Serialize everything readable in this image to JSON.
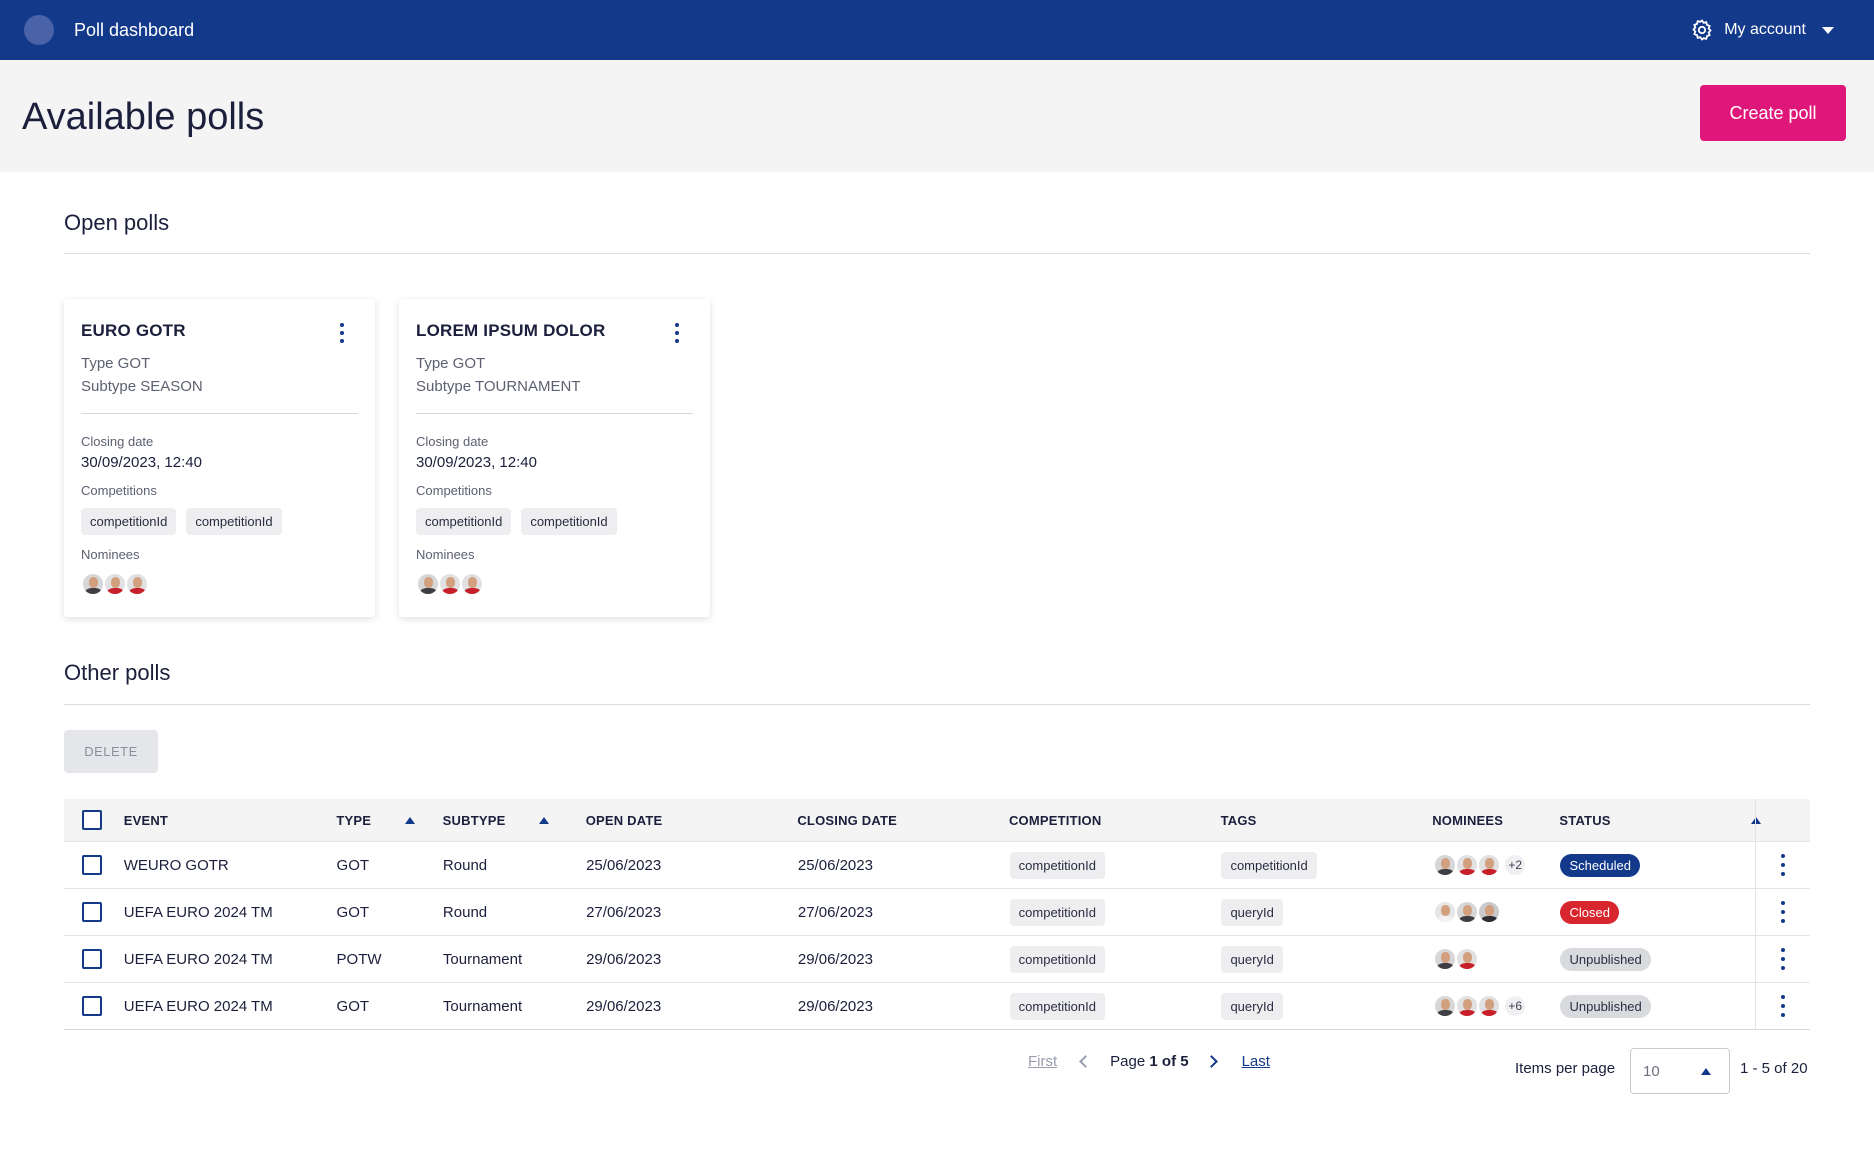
{
  "app": {
    "title": "Poll dashboard",
    "account_label": "My account"
  },
  "header": {
    "page_title": "Available polls",
    "create_button": "Create poll"
  },
  "open_polls": {
    "section_title": "Open polls",
    "cards": [
      {
        "title": "EURO GOTR",
        "type_line": "Type GOT",
        "subtype_line": "Subtype SEASON",
        "closing_label": "Closing date",
        "closing_date": "30/09/2023, 12:40",
        "competitions_label": "Competitions",
        "competitions": [
          "competitionId",
          "competitionId"
        ],
        "nominees_label": "Nominees",
        "nominee_icons": [
          "player-avatar-icon",
          "player-avatar-icon",
          "player-avatar-icon"
        ]
      },
      {
        "title": "LOREM IPSUM DOLOR",
        "type_line": "Type GOT",
        "subtype_line": "Subtype TOURNAMENT",
        "closing_label": "Closing date",
        "closing_date": "30/09/2023, 12:40",
        "competitions_label": "Competitions",
        "competitions": [
          "competitionId",
          "competitionId"
        ],
        "nominees_label": "Nominees",
        "nominee_icons": [
          "player-avatar-icon",
          "player-avatar-icon",
          "player-avatar-icon"
        ]
      }
    ]
  },
  "other_polls": {
    "section_title": "Other polls",
    "delete_button": "DELETE",
    "columns": {
      "event": "EVENT",
      "type": "TYPE",
      "subtype": "SUBTYPE",
      "open_date": "OPEN DATE",
      "closing_date": "CLOSING DATE",
      "competition": "COMPETITION",
      "tags": "TAGS",
      "nominees": "NOMINEES",
      "status": "STATUS"
    },
    "rows": [
      {
        "event": "WEURO GOTR",
        "type": "GOT",
        "subtype": "Round",
        "open_date": "25/06/2023",
        "closing_date": "25/06/2023",
        "competition": "competitionId",
        "tags": "competitionId",
        "nominees_extra": "+2",
        "status": "Scheduled"
      },
      {
        "event": "UEFA EURO 2024 TM",
        "type": "GOT",
        "subtype": "Round",
        "open_date": "27/06/2023",
        "closing_date": "27/06/2023",
        "competition": "competitionId",
        "tags": "queryId",
        "nominees_extra": "",
        "status": "Closed"
      },
      {
        "event": "UEFA EURO 2024 TM",
        "type": "POTW",
        "subtype": "Tournament",
        "open_date": "29/06/2023",
        "closing_date": "29/06/2023",
        "competition": "competitionId",
        "tags": "queryId",
        "nominees_extra": "",
        "status": "Unpublished"
      },
      {
        "event": "UEFA EURO 2024 TM",
        "type": "GOT",
        "subtype": "Tournament",
        "open_date": "29/06/2023",
        "closing_date": "29/06/2023",
        "competition": "competitionId",
        "tags": "queryId",
        "nominees_extra": "+6",
        "status": "Unpublished"
      }
    ]
  },
  "pagination": {
    "first": "First",
    "page_prefix": "Page",
    "page_current": "1",
    "page_of": "of",
    "page_total": "5",
    "last": "Last",
    "items_per_page_label": "Items per page",
    "items_per_page_value": "10",
    "range": "1 - 5 of 20"
  },
  "colors": {
    "brand_blue": "#13398a",
    "accent_pink": "#e0177a",
    "status_scheduled": "#13398a",
    "status_closed": "#d8262f",
    "status_unpublished": "#d9dadd"
  }
}
